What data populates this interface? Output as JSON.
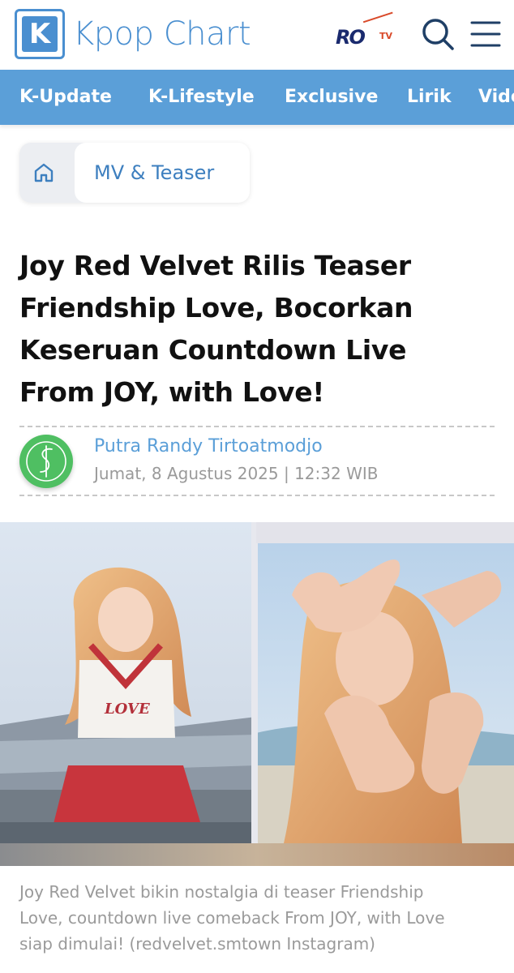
{
  "header": {
    "brand_letter": "K",
    "brand_name": "Kpop Chart",
    "partner_logo": {
      "ro": "RO",
      "tv": "TV"
    },
    "icons": {
      "search": "search-icon",
      "menu": "hamburger-menu-icon"
    }
  },
  "nav": {
    "items": [
      {
        "label": "K-Update"
      },
      {
        "label": "K-Lifestyle"
      },
      {
        "label": "Exclusive"
      },
      {
        "label": "Lirik"
      },
      {
        "label": "Video"
      }
    ]
  },
  "breadcrumb": {
    "home_icon": "home-icon",
    "category": "MV & Teaser"
  },
  "article": {
    "title_lines": [
      "Joy Red Velvet Rilis Teaser",
      "Friendship Love, Bocorkan",
      "Keseruan Countdown Live",
      "From JOY, with Love!"
    ],
    "author": "Putra Randy Tirtoatmodjo",
    "date": "Jumat, 8 Agustus 2025 | 12:32 WIB",
    "image_shirt_text": "LOVE",
    "caption_lines": [
      "Joy Red Velvet bikin nostalgia di teaser Friendship",
      "Love, countdown live comeback From JOY, with Love",
      "siap dimulai! (redvelvet.smtown Instagram)"
    ]
  },
  "colors": {
    "brand_blue": "#4a8fd0",
    "nav_bg": "#5b9fd8",
    "author_link": "#5b9fd8",
    "avatar_green": "#4fbf62",
    "title_text": "#111111",
    "muted_text": "#9a9a9a"
  }
}
